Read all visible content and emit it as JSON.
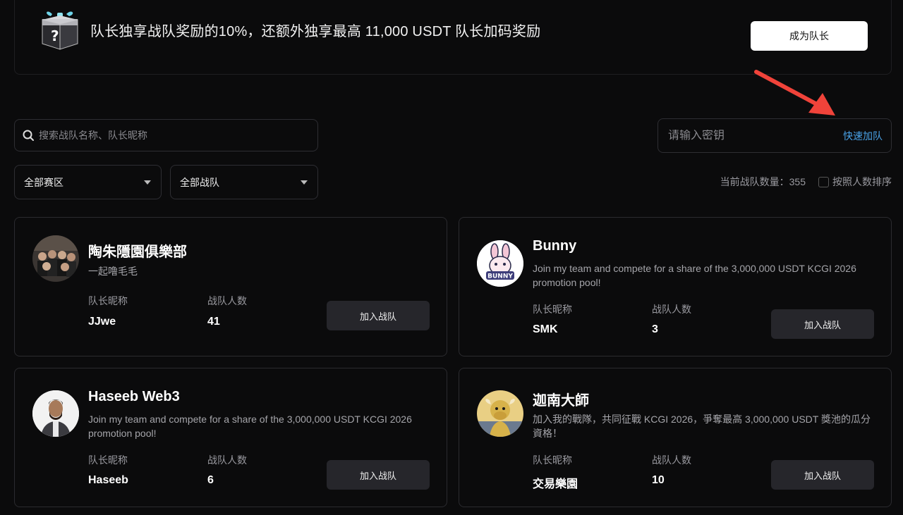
{
  "banner": {
    "text": "队长独享战队奖励的10%，还额外独享最高 11,000 USDT 队长加码奖励",
    "button": "成为队长"
  },
  "search": {
    "placeholder": "搜索战队名称、队长昵称"
  },
  "key_input": {
    "placeholder": "请输入密钥",
    "action": "快速加队"
  },
  "filters": {
    "region": "全部赛区",
    "team_type": "全部战队"
  },
  "stats": {
    "count_label": "当前战队数量：355",
    "sort_label": "按照人数排序"
  },
  "colors": {
    "accent": "#4aa3e8",
    "background": "#0b0b0c",
    "arrow": "#f0433a"
  },
  "teams": [
    {
      "name": "陶朱隱園俱樂部",
      "description": "一起噜毛毛",
      "captain_label": "队长昵称",
      "captain": "JJwe",
      "members_label": "战队人数",
      "members": "41",
      "join": "加入战队"
    },
    {
      "name": "Bunny",
      "description": "Join my team and compete for a share of the 3,000,000 USDT KCGI 2026 promotion pool!",
      "captain_label": "队长昵称",
      "captain": "SMK",
      "members_label": "战队人数",
      "members": "3",
      "join": "加入战队",
      "avatar_text": "BUNNY"
    },
    {
      "name": "Haseeb Web3",
      "description": "Join my team and compete for a share of the 3,000,000 USDT KCGI 2026 promotion pool!",
      "captain_label": "队长昵称",
      "captain": "Haseeb",
      "members_label": "战队人数",
      "members": "6",
      "join": "加入战队"
    },
    {
      "name": "迦南大師",
      "description": "加入我的戰隊，共同征戰 KCGI 2026，爭奪最高 3,000,000 USDT 獎池的瓜分資格！",
      "captain_label": "队长昵称",
      "captain": "交易樂園",
      "members_label": "战队人数",
      "members": "10",
      "join": "加入战队"
    }
  ]
}
